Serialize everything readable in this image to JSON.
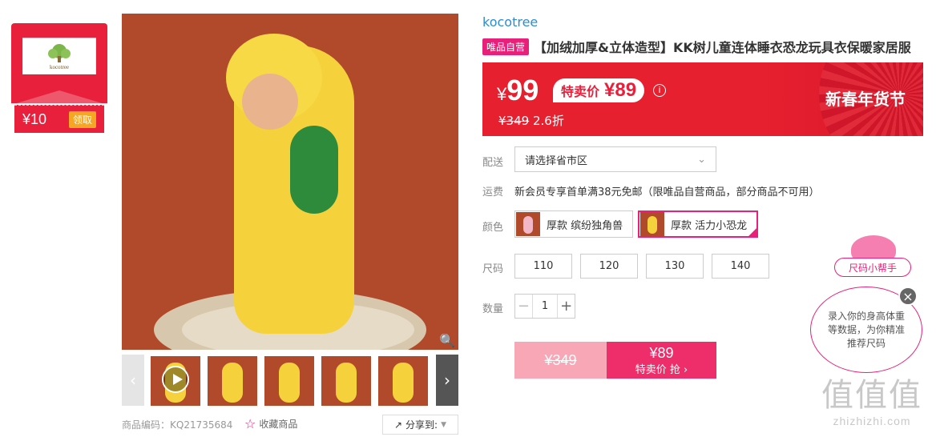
{
  "coupon": {
    "logo_text": "kocotree",
    "amount": "¥10",
    "claim_label": "领取"
  },
  "gallery": {
    "zoom_icon": "magnifier-icon",
    "thumb_count": 6,
    "prev_icon": "chevron-left-icon",
    "next_icon": "chevron-right-icon"
  },
  "product": {
    "code_label": "商品编码：",
    "code": "KQ21735684",
    "favorite_label": "收藏商品",
    "share_label": "分享到:",
    "brand": "kocotree",
    "self_tag": "唯品自营",
    "title": "【加绒加厚&立体造型】KK树儿童连体睡衣恐龙玩具衣保暖家居服"
  },
  "price": {
    "currency": "¥",
    "current": "99",
    "special_label": "特卖价",
    "special_value": "¥89",
    "original": "¥349",
    "discount": "2.6折",
    "festival": "新春年货节"
  },
  "delivery": {
    "label": "配送",
    "placeholder": "请选择省市区"
  },
  "shipping": {
    "label": "运费",
    "text": "新会员专享首单满38元免邮（限唯品自营商品，部分商品不可用）"
  },
  "color": {
    "label": "颜色",
    "options": [
      "厚款 缤纷独角兽",
      "厚款 活力小恐龙"
    ],
    "selected": "厚款 活力小恐龙"
  },
  "size": {
    "label": "尺码",
    "options": [
      "110",
      "120",
      "130",
      "140"
    ]
  },
  "quantity": {
    "label": "数量",
    "value": "1",
    "minus": "−",
    "plus": "+"
  },
  "buy": {
    "original": "¥349",
    "price": "¥89",
    "action": "特卖价 抢 ›"
  },
  "helper": {
    "title": "尺码小帮手",
    "text": "录入你的身高体重等数据，为你精准推荐尺码",
    "close": "×"
  },
  "watermark": {
    "logo": "值值值",
    "url": "zhizhizhi.com"
  },
  "colors": {
    "accent": "#e8207a",
    "red": "#e8203b",
    "brand_link": "#2a8dd4"
  }
}
